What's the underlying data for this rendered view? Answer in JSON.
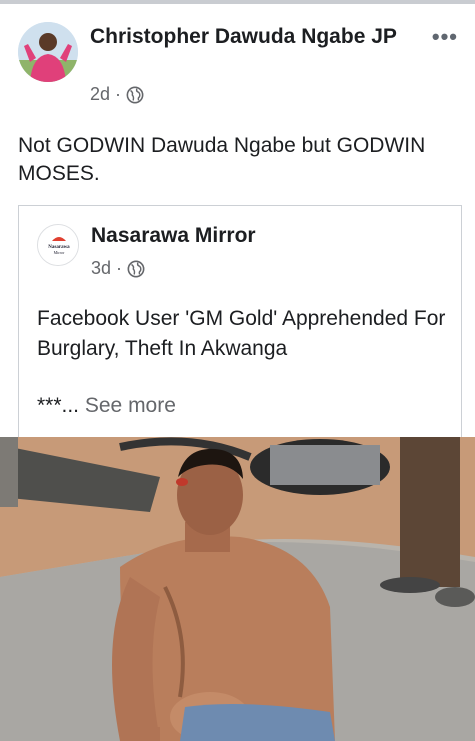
{
  "post": {
    "author": "Christopher Dawuda Ngabe JP",
    "time": "2d",
    "separator": "·",
    "privacy_icon": "globe-icon",
    "more_icon": "•••",
    "text": "Not GODWIN Dawuda Ngabe but GODWIN MOSES."
  },
  "shared": {
    "page_name": "Nasarawa Mirror",
    "avatar_text_line1": "Nasarawa",
    "avatar_text_line2": "Mirror",
    "time": "3d",
    "separator": "·",
    "text": "Facebook User 'GM Gold' Apprehended For Burglary, Theft In Akwanga",
    "truncated": "***...",
    "see_more": " See more"
  },
  "colors": {
    "text": "#1c1e21",
    "secondary": "#65676b",
    "border": "#ccd0d5"
  }
}
